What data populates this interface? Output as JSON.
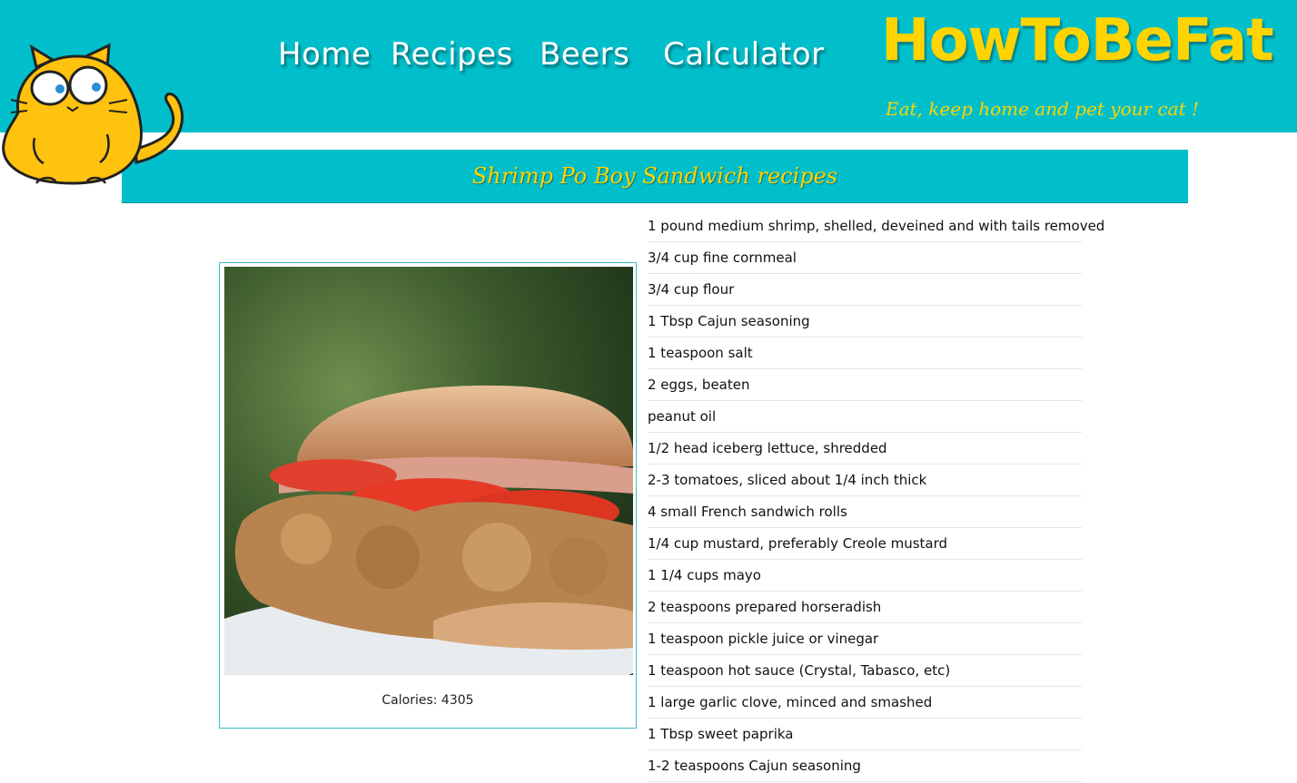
{
  "brand": {
    "logo": "HowToBeFat",
    "tagline": "Eat, keep home and pet your cat !"
  },
  "nav": {
    "home": "Home",
    "recipes": "Recipes",
    "beers": "Beers",
    "calculator": "Calculator"
  },
  "recipe": {
    "title": "Shrimp Po Boy Sandwich recipes",
    "calories": "Calories: 4305",
    "ingredients": [
      "1 pound medium shrimp, shelled, deveined and with tails removed",
      "3/4 cup fine cornmeal",
      "3/4 cup flour",
      "1 Tbsp Cajun seasoning",
      "1 teaspoon salt",
      "2 eggs, beaten",
      "peanut oil",
      "1/2 head iceberg lettuce, shredded",
      "2-3 tomatoes, sliced about 1/4 inch thick",
      "4 small French sandwich rolls",
      "1/4 cup mustard, preferably Creole mustard",
      "1 1/4 cups mayo",
      "2 teaspoons prepared horseradish",
      "1 teaspoon pickle juice or vinegar",
      "1 teaspoon hot sauce (Crystal, Tabasco, etc)",
      "1 large garlic clove, minced and smashed",
      "1 Tbsp sweet paprika",
      "1-2 teaspoons Cajun seasoning"
    ]
  },
  "colors": {
    "header_bg": "#00bfcb",
    "accent_yellow": "#ffd400"
  },
  "icons": {
    "mascot": "fat-cat-icon",
    "photo": "sandwich-photo"
  }
}
